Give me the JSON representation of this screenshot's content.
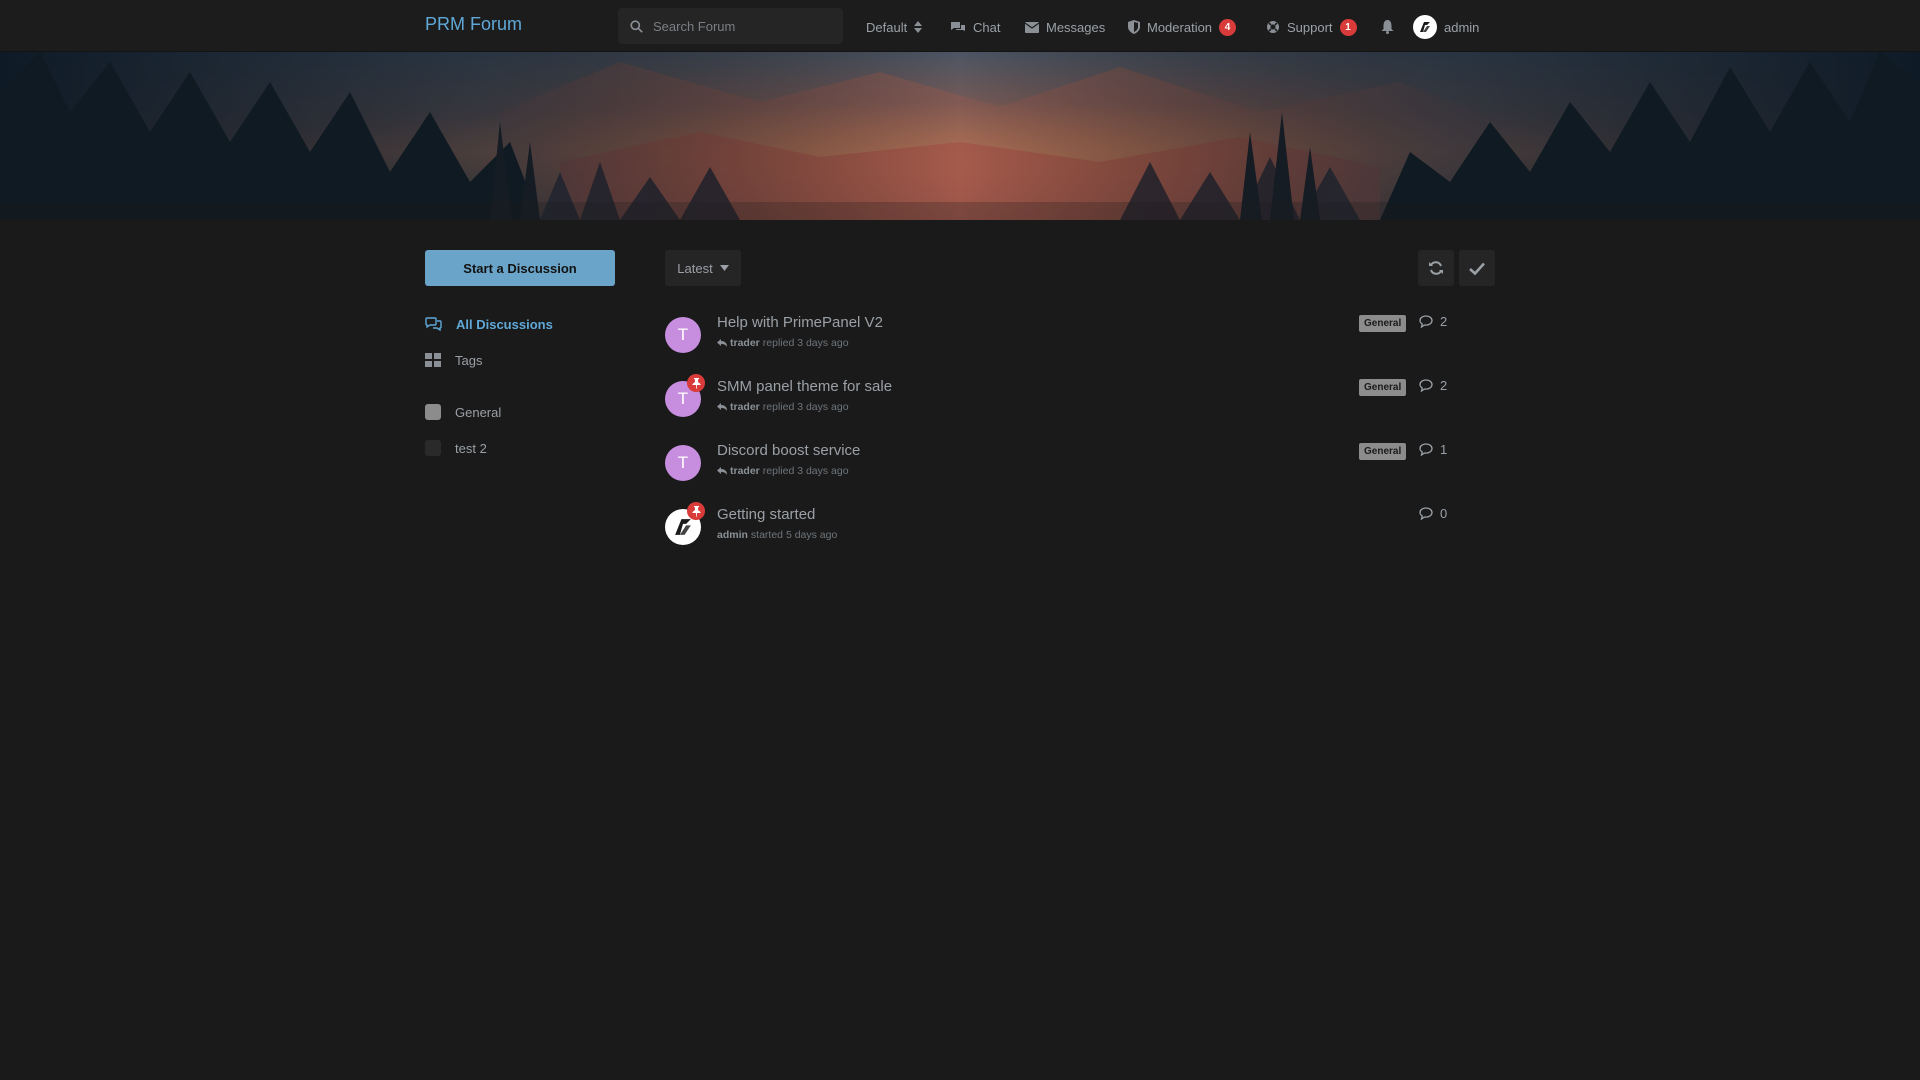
{
  "header": {
    "brand": "PRM Forum",
    "search_placeholder": "Search Forum",
    "nav": {
      "default_label": "Default",
      "chat_label": "Chat",
      "messages_label": "Messages",
      "moderation_label": "Moderation",
      "moderation_count": "4",
      "support_label": "Support",
      "support_count": "1",
      "user_label": "admin"
    }
  },
  "sidebar": {
    "start_button": "Start a Discussion",
    "all_discussions": "All Discussions",
    "tags": "Tags",
    "tag_items": [
      {
        "label": "General",
        "color": "#8c8c8c"
      },
      {
        "label": "test 2",
        "color": "#2a2a2a"
      }
    ]
  },
  "toolbar": {
    "sort_label": "Latest"
  },
  "discussions": [
    {
      "title": "Help with PrimePanel V2",
      "author": "trader",
      "action": "replied 3 days ago",
      "tag": "General",
      "count": "2",
      "avatar": "T",
      "pinned": false
    },
    {
      "title": "SMM panel theme for sale",
      "author": "trader",
      "action": "replied 3 days ago",
      "tag": "General",
      "count": "2",
      "avatar": "T",
      "pinned": true
    },
    {
      "title": "Discord boost service",
      "author": "trader",
      "action": "replied 3 days ago",
      "tag": "General",
      "count": "1",
      "avatar": "T",
      "pinned": false
    },
    {
      "title": "Getting started",
      "author": "admin",
      "action": "started 5 days ago",
      "tag": "",
      "count": "0",
      "avatar": "",
      "pinned": true
    }
  ],
  "colors": {
    "accent": "#5fa8d8",
    "button": "#6aa5c9",
    "badge": "#d93b3b",
    "avatar_user": "#c78ee0"
  }
}
